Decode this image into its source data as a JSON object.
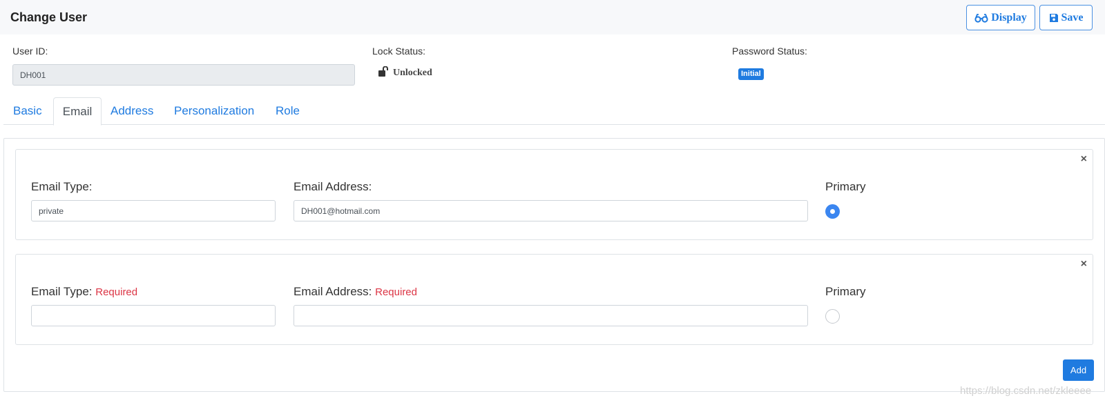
{
  "header": {
    "title": "Change User",
    "display_label": "Display",
    "save_label": "Save"
  },
  "info": {
    "user_id_label": "User ID:",
    "user_id_value": "DH001",
    "lock_status_label": "Lock Status:",
    "lock_status_value": "Unlocked",
    "password_status_label": "Password Status:",
    "password_status_value": "Initial"
  },
  "tabs": [
    {
      "label": "Basic",
      "active": false
    },
    {
      "label": "Email",
      "active": true
    },
    {
      "label": "Address",
      "active": false
    },
    {
      "label": "Personalization",
      "active": false
    },
    {
      "label": "Role",
      "active": false
    }
  ],
  "emails": [
    {
      "type_label": "Email Type:",
      "type_value": "private",
      "type_error": "",
      "address_label": "Email Address:",
      "address_value": "DH001@hotmail.com",
      "address_error": "",
      "primary_label": "Primary",
      "primary": true
    },
    {
      "type_label": "Email Type:",
      "type_value": "",
      "type_error": "Required",
      "address_label": "Email Address:",
      "address_value": "",
      "address_error": "Required",
      "primary_label": "Primary",
      "primary": false
    }
  ],
  "close_symbol": "×",
  "add_label": "Add",
  "watermark": "https://blog.csdn.net/zkleeee",
  "colors": {
    "accent": "#1f7be0",
    "error": "#dc3545",
    "radio_checked": "#3b86f0"
  }
}
